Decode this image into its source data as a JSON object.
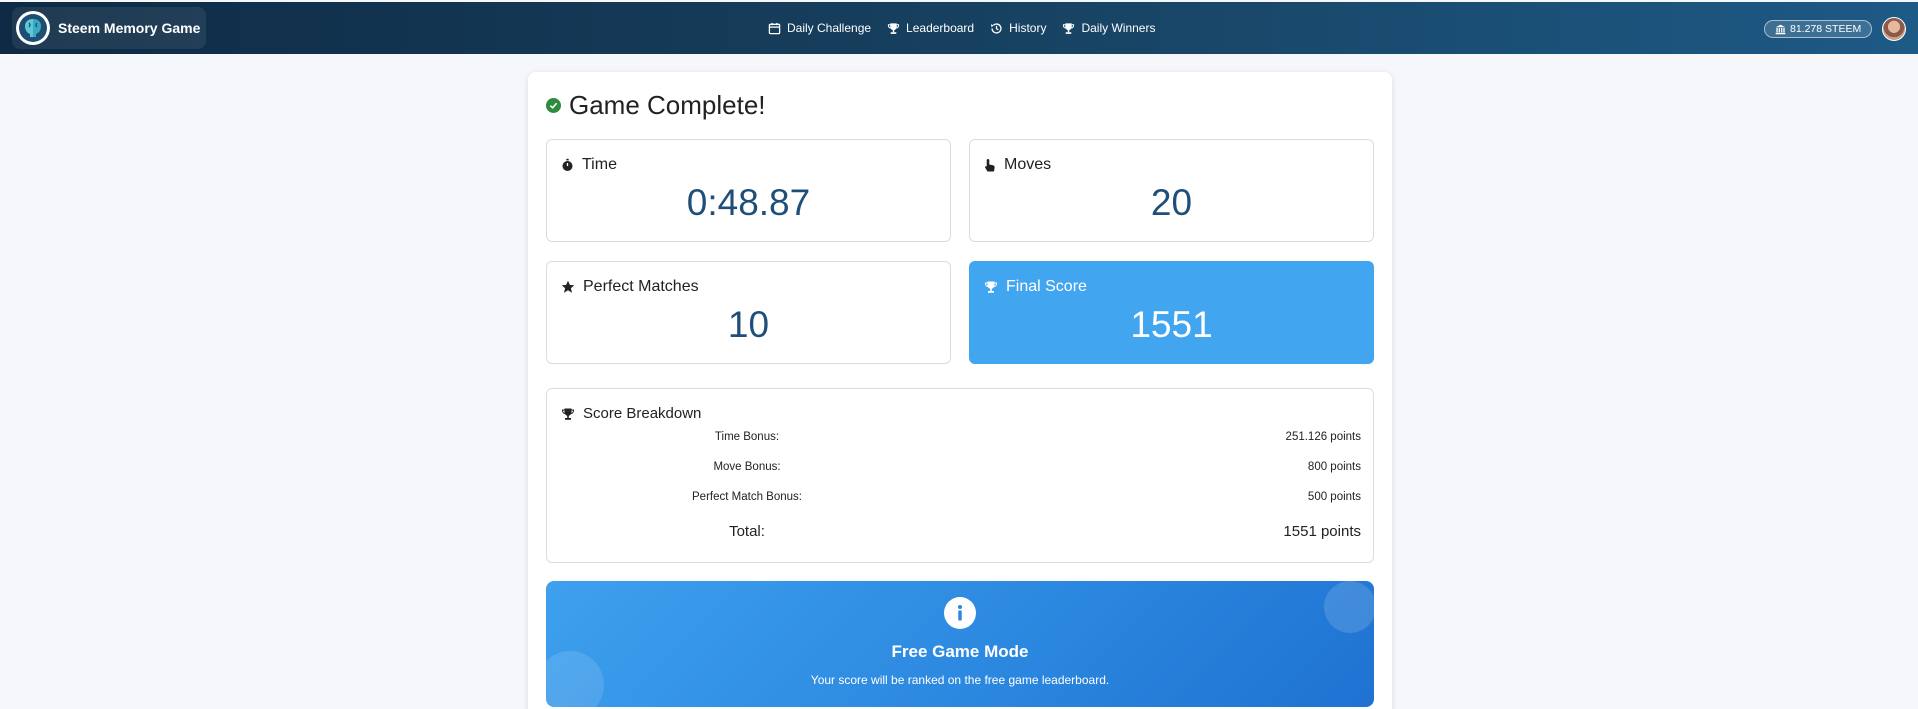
{
  "header": {
    "brand": "Steem Memory Game",
    "nav": [
      {
        "label": "Daily Challenge",
        "icon": "calendar-icon"
      },
      {
        "label": "Leaderboard",
        "icon": "trophy-icon"
      },
      {
        "label": "History",
        "icon": "history-icon"
      },
      {
        "label": "Daily Winners",
        "icon": "trophy-icon"
      }
    ],
    "wallet": "81.278 STEEM"
  },
  "result": {
    "title": "Game Complete!",
    "stats": {
      "time": {
        "label": "Time",
        "value": "0:48.87"
      },
      "moves": {
        "label": "Moves",
        "value": "20"
      },
      "perfect": {
        "label": "Perfect Matches",
        "value": "10"
      },
      "final": {
        "label": "Final Score",
        "value": "1551"
      }
    },
    "breakdown": {
      "title": "Score Breakdown",
      "rows": [
        {
          "label": "Time Bonus:",
          "value": "251.126 points"
        },
        {
          "label": "Move Bonus:",
          "value": "800 points"
        },
        {
          "label": "Perfect Match Bonus:",
          "value": "500 points"
        }
      ],
      "total": {
        "label": "Total:",
        "value": "1551 points"
      }
    },
    "banner": {
      "title": "Free Game Mode",
      "text": "Your score will be ranked on the free game leaderboard."
    }
  },
  "colors": {
    "accent": "#42a5f0",
    "success": "#2e8b3e",
    "navbar": "#17405f"
  }
}
